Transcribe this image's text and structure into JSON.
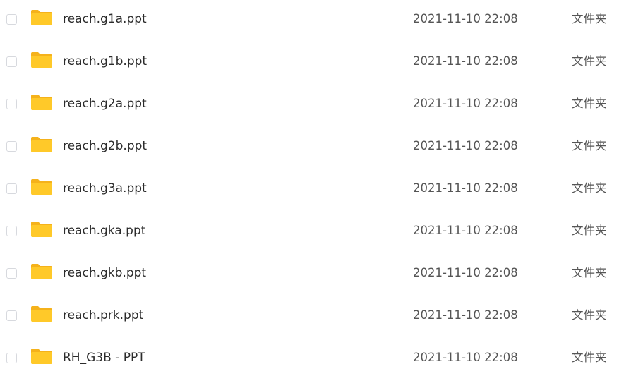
{
  "files": [
    {
      "name": "reach.g1a.ppt",
      "modified": "2021-11-10 22:08",
      "type": "文件夹",
      "icon": "folder-icon"
    },
    {
      "name": "reach.g1b.ppt",
      "modified": "2021-11-10 22:08",
      "type": "文件夹",
      "icon": "folder-icon"
    },
    {
      "name": "reach.g2a.ppt",
      "modified": "2021-11-10 22:08",
      "type": "文件夹",
      "icon": "folder-icon"
    },
    {
      "name": "reach.g2b.ppt",
      "modified": "2021-11-10 22:08",
      "type": "文件夹",
      "icon": "folder-icon"
    },
    {
      "name": "reach.g3a.ppt",
      "modified": "2021-11-10 22:08",
      "type": "文件夹",
      "icon": "folder-icon"
    },
    {
      "name": "reach.gka.ppt",
      "modified": "2021-11-10 22:08",
      "type": "文件夹",
      "icon": "folder-icon"
    },
    {
      "name": "reach.gkb.ppt",
      "modified": "2021-11-10 22:08",
      "type": "文件夹",
      "icon": "folder-icon"
    },
    {
      "name": "reach.prk.ppt",
      "modified": "2021-11-10 22:08",
      "type": "文件夹",
      "icon": "folder-icon"
    },
    {
      "name": "RH_G3B - PPT",
      "modified": "2021-11-10 22:08",
      "type": "文件夹",
      "icon": "folder-icon"
    }
  ],
  "colors": {
    "folder_main": "#FFC929",
    "folder_tab": "#F5B21B",
    "checkbox_border": "#D7D9DE"
  }
}
